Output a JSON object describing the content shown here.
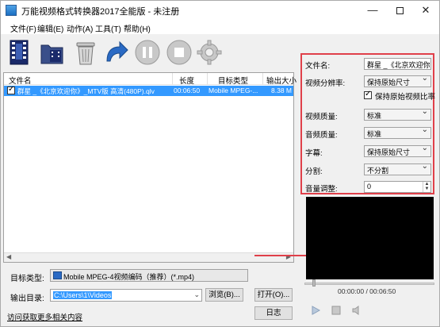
{
  "window": {
    "title": "万能视频格式转换器2017全能版 - 未注册",
    "minimize": "—",
    "close": "✕"
  },
  "menu": [
    "文件(F)",
    "编辑(E)",
    "动作(A)",
    "工具(T)",
    "帮助(H)"
  ],
  "toolbar": {
    "icons": [
      "add-video-icon",
      "add-folder-icon",
      "delete-icon",
      "redo-icon",
      "pause-icon",
      "stop-icon",
      "settings-gear-icon"
    ]
  },
  "file_list": {
    "columns": [
      "文件名",
      "长度",
      "目标类型",
      "输出大小"
    ],
    "rows": [
      {
        "name": "群星 _《北京欢迎你》_MTV版 高清(480P).qlv",
        "length": "00:06:50",
        "target": "Mobile MPEG-...",
        "size": "8.38 M",
        "checked": true
      }
    ]
  },
  "output": {
    "target_label": "目标类型:",
    "target_value": "Mobile MPEG-4视频编码（推荐）(*.mp4)",
    "dir_label": "输出目录:",
    "dir_value": "C:\\Users\\1\\Videos",
    "browse_button": "浏览(B)...",
    "open_button": "打开(O)...",
    "log_button": "日志",
    "link_text": "访问获取更多相关内容"
  },
  "settings": {
    "filename_label": "文件名:",
    "filename_value": "群星 _《北京欢迎你》",
    "resolution_label": "视频分辨率:",
    "resolution_value": "保持原始尺寸",
    "keep_ratio_label": "保持原始视频比率",
    "keep_ratio_checked": true,
    "video_quality_label": "视频质量:",
    "video_quality_value": "标准",
    "audio_quality_label": "音频质量:",
    "audio_quality_value": "标准",
    "subtitle_label": "字幕:",
    "subtitle_value": "保持原始尺寸",
    "split_label": "分割:",
    "split_value": "不分割",
    "volume_label": "音量调整:",
    "volume_value": "0"
  },
  "preview": {
    "time": "00:00:00 / 00:06:50",
    "controls": [
      "play-icon",
      "stop-icon",
      "volume-icon"
    ]
  },
  "colors": {
    "selection": "#3399ff",
    "highlight_border": "#e0404a",
    "preview_bg": "#000000"
  }
}
